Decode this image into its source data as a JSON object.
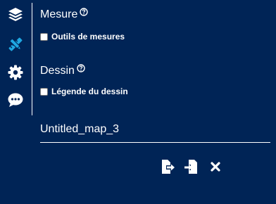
{
  "sidebar": {
    "items": [
      {
        "icon": "layers-icon"
      },
      {
        "icon": "pencil-ruler-icon",
        "active": true
      },
      {
        "icon": "gear-icon"
      },
      {
        "icon": "comment-icon"
      }
    ]
  },
  "sections": {
    "mesure": {
      "title": "Mesure",
      "checkbox_label": "Outils de mesures",
      "checked": false
    },
    "dessin": {
      "title": "Dessin",
      "checkbox_label": "Légende du dessin",
      "checked": false
    }
  },
  "map": {
    "title": "Untitled_map_3"
  },
  "actions": {
    "icons": [
      "export-file-icon",
      "import-file-icon",
      "close-icon"
    ]
  },
  "colors": {
    "background": "#002456",
    "active_icon": "#1fa7e1",
    "foreground": "#ffffff"
  }
}
